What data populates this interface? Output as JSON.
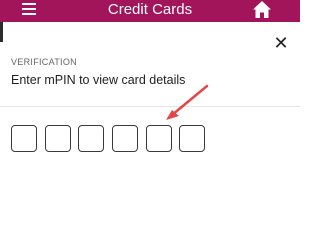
{
  "header": {
    "title": "Credit Cards",
    "menu_icon": "hamburger-menu-icon",
    "home_icon": "home-icon"
  },
  "dialog": {
    "section_label": "VERIFICATION",
    "instruction": "Enter mPIN to view card details",
    "close_icon": "close-icon",
    "pin_length": 6
  },
  "colors": {
    "brand": "#a3155a",
    "annotation": "#e0484a",
    "pin_border": "#3a3a3a"
  }
}
